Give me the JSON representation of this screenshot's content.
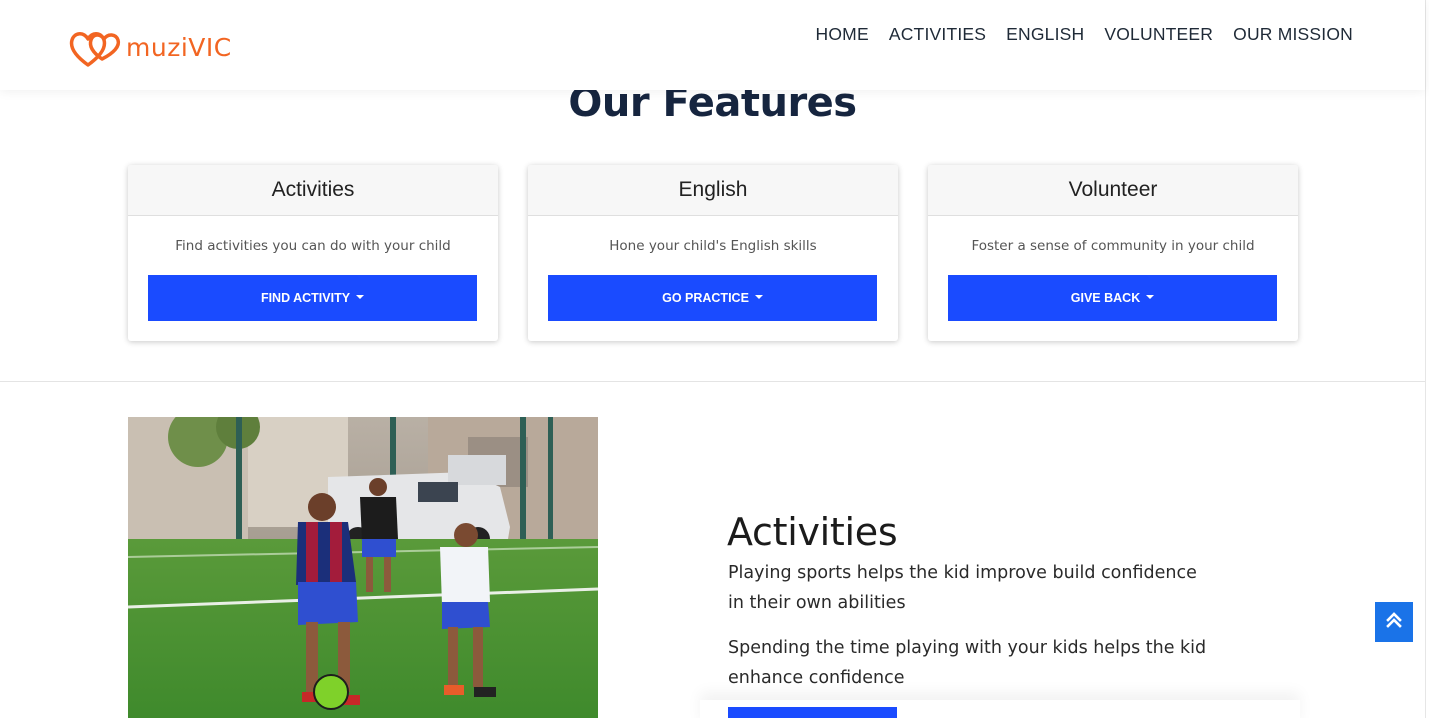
{
  "brand": {
    "name": "muziVIC",
    "logo_icon": "double-heart-icon",
    "brand_color": "#f26522"
  },
  "nav": {
    "items": [
      {
        "label": "HOME"
      },
      {
        "label": "ACTIVITIES"
      },
      {
        "label": "ENGLISH"
      },
      {
        "label": "VOLUNTEER"
      },
      {
        "label": "OUR MISSION"
      }
    ]
  },
  "features": {
    "title": "Our Features",
    "cards": [
      {
        "title": "Activities",
        "text": "Find activities you can do with your child",
        "button": "FIND ACTIVITY"
      },
      {
        "title": "English",
        "text": "Hone your child's English skills",
        "button": "GO PRACTICE"
      },
      {
        "title": "Volunteer",
        "text": "Foster a sense of community in your child",
        "button": "GIVE BACK"
      }
    ]
  },
  "activities_section": {
    "title": "Activities",
    "paragraphs": [
      "Playing sports helps the kid improve build confidence in their own abilities",
      "Spending the time playing with your kids helps the kid enhance confidence"
    ]
  },
  "scroll_top": {
    "icon": "double-chevron-up-icon"
  },
  "colors": {
    "accent": "#1a4bff",
    "scroll_button": "#1a73e8",
    "heading": "#16253f"
  }
}
